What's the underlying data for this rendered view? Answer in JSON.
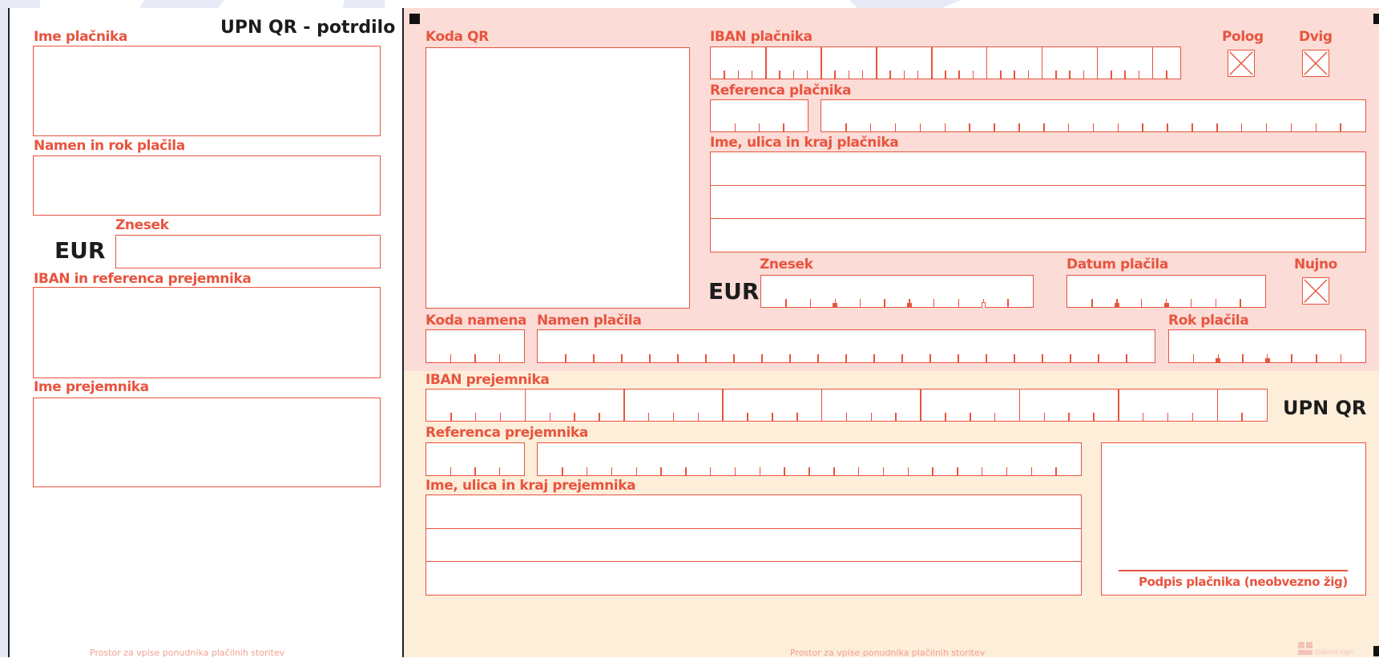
{
  "colors": {
    "accent": "#e8543f",
    "pink_zone": "#fbdcd6",
    "peach_zone": "#fdeeda",
    "text_dark": "#1c1c1c",
    "stripe": "#dfe3f3"
  },
  "receipt": {
    "title": "UPN QR - potrdilo",
    "payer_name_label": "Ime plačnika",
    "purpose_deadline_label": "Namen in rok plačila",
    "amount_label": "Znesek",
    "currency": "EUR",
    "iban_ref_label": "IBAN in referenca prejemnika",
    "recipient_name_label": "Ime prejemnika",
    "footer": "Prostor za vpise ponudnika plačilnih storitev"
  },
  "order": {
    "qr_label": "Koda QR",
    "payer_iban_label": "IBAN plačnika",
    "deposit_label": "Polog",
    "withdraw_label": "Dvig",
    "payer_reference_label": "Referenca plačnika",
    "payer_address_label": "Ime, ulica in kraj plačnika",
    "amount_label": "Znesek",
    "currency": "EUR",
    "payment_date_label": "Datum plačila",
    "urgent_label": "Nujno",
    "purpose_code_label": "Koda namena",
    "purpose_label": "Namen plačila",
    "deadline_label": "Rok plačila",
    "recipient_iban_label": "IBAN prejemnika",
    "brand": "UPN QR",
    "recipient_reference_label": "Referenca prejemnika",
    "recipient_address_label": "Ime, ulica in kraj prejemnika",
    "signature_label": "Podpis plačnika (neobvezno žig)",
    "footer": "Prostor za vpise ponudnika plačilnih storitev",
    "logo_text": "Dabver.sign"
  }
}
